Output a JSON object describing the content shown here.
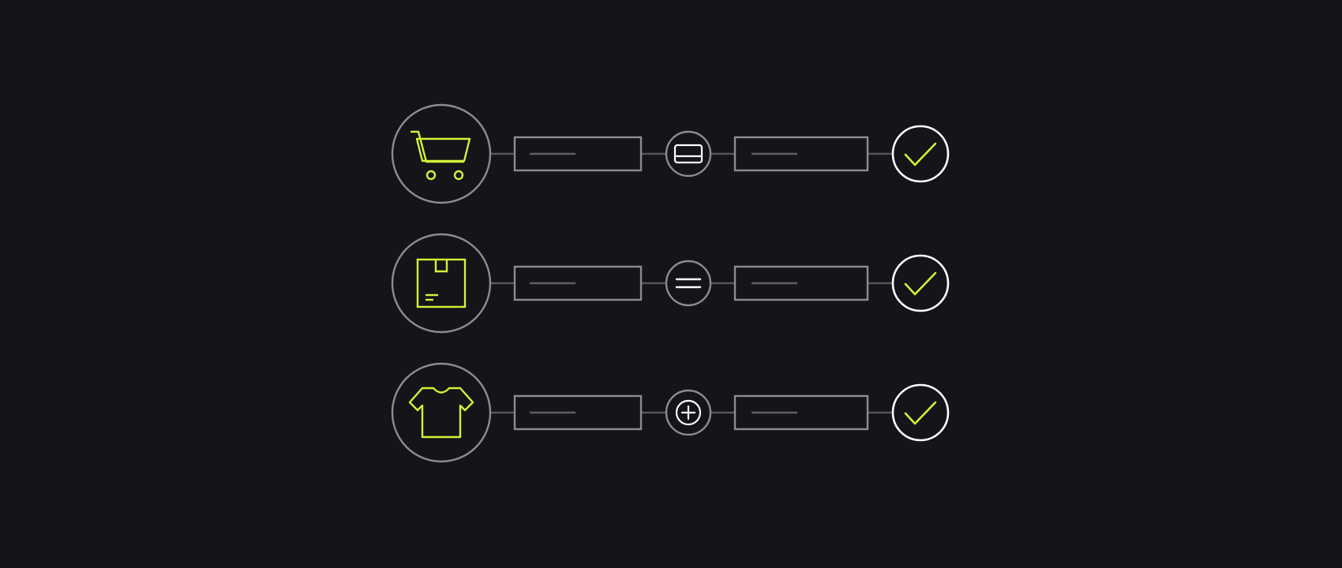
{
  "theme": {
    "background": "#141419",
    "stroke_muted": "#8d8c92",
    "connector": "#55555a",
    "placeholder_line": "#5f5e64",
    "accent": "#d7f134",
    "white": "#ffffff"
  },
  "rows": [
    {
      "id": "cart",
      "icon": "shopping-cart-icon",
      "action_icon": "credit-card-icon",
      "status_icon": "checkmark-icon"
    },
    {
      "id": "package",
      "icon": "package-box-icon",
      "action_icon": "equals-icon",
      "status_icon": "checkmark-icon"
    },
    {
      "id": "apparel",
      "icon": "tshirt-icon",
      "action_icon": "plus-circle-icon",
      "status_icon": "checkmark-icon"
    }
  ]
}
